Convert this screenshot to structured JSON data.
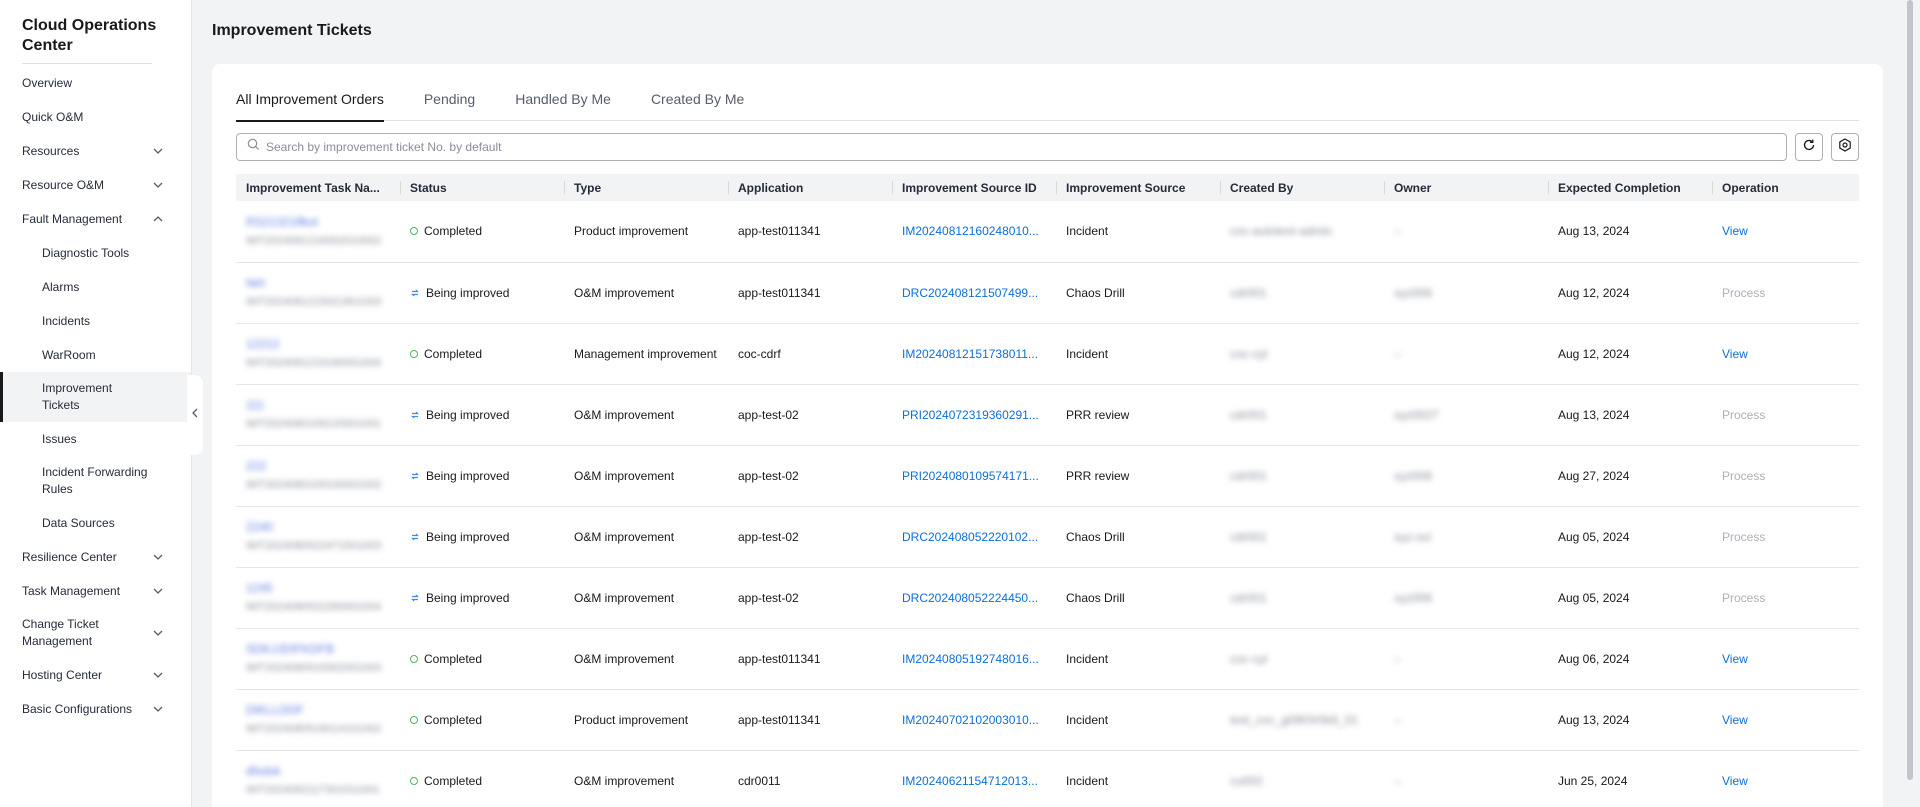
{
  "sidebar": {
    "title_line1": "Cloud Operations",
    "title_line2": "Center",
    "items": [
      {
        "label": "Overview"
      },
      {
        "label": "Quick O&M"
      },
      {
        "label": "Resources"
      },
      {
        "label": "Resource O&M"
      },
      {
        "label": "Fault Management"
      },
      {
        "label": "Diagnostic Tools"
      },
      {
        "label": "Alarms"
      },
      {
        "label": "Incidents"
      },
      {
        "label": "WarRoom"
      },
      {
        "label": "Improvement Tickets"
      },
      {
        "label": "Issues"
      },
      {
        "label": "Incident Forwarding Rules"
      },
      {
        "label": "Data Sources"
      },
      {
        "label": "Resilience Center"
      },
      {
        "label": "Task Management"
      },
      {
        "label": "Change Ticket Management"
      },
      {
        "label": "Hosting Center"
      },
      {
        "label": "Basic Configurations"
      }
    ]
  },
  "page": {
    "title": "Improvement Tickets"
  },
  "tabs": [
    "All Improvement Orders",
    "Pending",
    "Handled By Me",
    "Created By Me"
  ],
  "search": {
    "placeholder": "Search by improvement ticket No. by default"
  },
  "table": {
    "headers": [
      "Improvement Task Na...",
      "Status",
      "Type",
      "Application",
      "Improvement Source ID",
      "Improvement Source",
      "Created By",
      "Owner",
      "Expected Completion",
      "Operation"
    ],
    "rows": [
      {
        "name": "RS21321ffkol",
        "no": "IMT2024081216002010002",
        "status": "Completed",
        "type": "Product improvement",
        "app": "app-test011341",
        "source_id": "IM20240812160248010...",
        "source": "Incident",
        "created_by": "coc-autotest-admin",
        "owner": "--",
        "expected": "Aug 13, 2024",
        "op": "View"
      },
      {
        "name": "hkh",
        "no": "IMT2024081215021801003",
        "status": "Being improved",
        "type": "O&M improvement",
        "app": "app-test011341",
        "source_id": "DRC202408121507499...",
        "source": "Chaos Drill",
        "created_by": "cdr001",
        "owner": "xyz006",
        "expected": "Aug 12, 2024",
        "op": "Process"
      },
      {
        "name": "12212",
        "no": "IMT2024081215190001004",
        "status": "Completed",
        "type": "Management improvement",
        "app": "coc-cdrf",
        "source_id": "IM20240812151738011...",
        "source": "Incident",
        "created_by": "coc-cyl",
        "owner": "--",
        "expected": "Aug 12, 2024",
        "op": "View"
      },
      {
        "name": "111",
        "no": "IMT2024080109120001001",
        "status": "Being improved",
        "type": "O&M improvement",
        "app": "app-test-02",
        "source_id": "PRI2024072319360291...",
        "source": "PRR review",
        "created_by": "cdr001",
        "owner": "xyz0027",
        "expected": "Aug 13, 2024",
        "op": "Process"
      },
      {
        "name": "222",
        "no": "IMT2024080109100001002",
        "status": "Being improved",
        "type": "O&M improvement",
        "app": "app-test-02",
        "source_id": "PRI2024080109574171...",
        "source": "PRR review",
        "created_by": "cdr001",
        "owner": "xyz006",
        "expected": "Aug 27, 2024",
        "op": "Process"
      },
      {
        "name": "2240",
        "no": "IMT2024080522471501003",
        "status": "Being improved",
        "type": "O&M improvement",
        "app": "app-test-02",
        "source_id": "DRC202408052220102...",
        "source": "Chaos Drill",
        "created_by": "cdr001",
        "owner": "xyz-ocl",
        "expected": "Aug 05, 2024",
        "op": "Process"
      },
      {
        "name": "1245",
        "no": "IMT2024080522260001004",
        "status": "Being improved",
        "type": "O&M improvement",
        "app": "app-test-02",
        "source_id": "DRC202408052224450...",
        "source": "Chaos Drill",
        "created_by": "cdr001",
        "owner": "xyz006",
        "expected": "Aug 05, 2024",
        "op": "Process"
      },
      {
        "name": "SDKJJDIFKDFB",
        "no": "IMT2024080519302001003",
        "status": "Completed",
        "type": "O&M improvement",
        "app": "app-test011341",
        "source_id": "IM20240805192748016...",
        "source": "Incident",
        "created_by": "coc-cyl",
        "owner": "--",
        "expected": "Aug 06, 2024",
        "op": "View"
      },
      {
        "name": "DIKLLDDF",
        "no": "IMT2024080516014101002",
        "status": "Completed",
        "type": "Product improvement",
        "app": "app-test011341",
        "source_id": "IM20240702102003010...",
        "source": "Incident",
        "created_by": "test_coc_g0903r5k6_01",
        "owner": "--",
        "expected": "Aug 13, 2024",
        "op": "View"
      },
      {
        "name": "dfsdsk",
        "no": "IMT2024062117301011001",
        "status": "Completed",
        "type": "O&M improvement",
        "app": "cdr0011",
        "source_id": "IM20240621154712013...",
        "source": "Incident",
        "created_by": "cu002",
        "owner": "--",
        "expected": "Jun 25, 2024",
        "op": "View"
      }
    ]
  },
  "colors": {
    "accent": "#0b6fd9",
    "completed": "#50b464",
    "improving": "#3a8ee6",
    "disabled": "#adb0b8"
  },
  "icons": [
    "search-icon",
    "refresh-icon",
    "settings-icon",
    "chevron-down-icon",
    "chevron-up-icon",
    "chevron-left-icon",
    "status-completed-icon",
    "status-improving-icon"
  ]
}
